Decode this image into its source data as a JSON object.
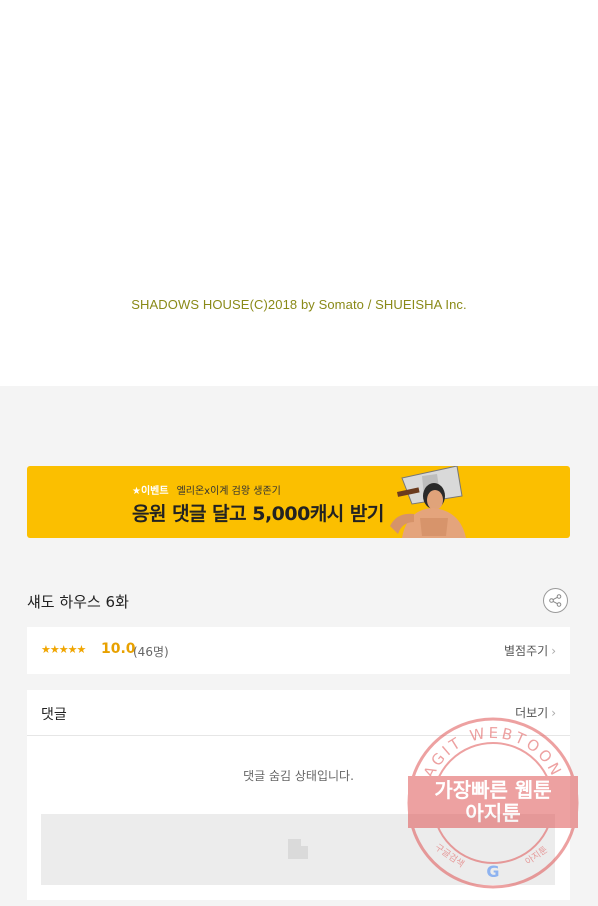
{
  "copyright": "SHADOWS HOUSE(C)2018 by Somato / SHUEISHA Inc.",
  "banner": {
    "tag": "★이벤트",
    "subtitle": "엘리온x이계 검왕 생존기",
    "headline": "응원 댓글 달고 5,000캐시 받기"
  },
  "episode": {
    "title": "섀도 하우스 6화"
  },
  "rating": {
    "stars": "★★★★★",
    "score": "10.0",
    "count": "(46명)",
    "rate_label": "별점주기",
    "chevron": "›"
  },
  "comments": {
    "title": "댓글",
    "more_label": "더보기",
    "chevron": "›",
    "hidden_message": "댓글 숨김 상태입니다."
  },
  "watermark": {
    "arc_text": "AGIT WEBTOON",
    "line1": "가장빠른 웹툰",
    "line2": "아지툰",
    "bottom_left": "구글검색",
    "bottom_right": "아지툰",
    "google": "G"
  },
  "colors": {
    "banner_bg": "#fbbf00",
    "star": "#f0a500",
    "stamp": "#e05555"
  }
}
